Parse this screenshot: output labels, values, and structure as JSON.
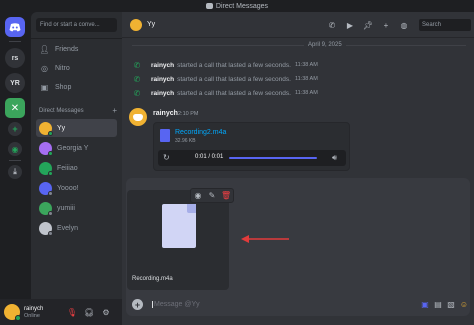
{
  "window": {
    "title": "Direct Messages"
  },
  "rail": {
    "servers": [
      {
        "label": "rs"
      },
      {
        "label": "YR"
      },
      {
        "label": ""
      }
    ]
  },
  "sidebar": {
    "search_placeholder": "Find or start a conve...",
    "nav": [
      {
        "label": "Friends",
        "icon": "friends-icon"
      },
      {
        "label": "Nitro",
        "icon": "nitro-icon"
      },
      {
        "label": "Shop",
        "icon": "shop-icon"
      }
    ],
    "dm_header": "Direct Messages",
    "dm_add": "+",
    "dms": [
      {
        "name": "Yy",
        "color": "#f0b232",
        "online": true,
        "active": true
      },
      {
        "name": "Georgia Y",
        "color": "#a56ef2",
        "online": true,
        "active": false
      },
      {
        "name": "Feiiiao",
        "color": "#23a55a",
        "online": true,
        "active": false
      },
      {
        "name": "Yoooo!",
        "color": "#5865f2",
        "online": false,
        "active": false
      },
      {
        "name": "yumiii",
        "color": "#3ba55c",
        "online": false,
        "active": false
      },
      {
        "name": "Evelyn",
        "color": "#c0c4cc",
        "online": false,
        "active": false
      }
    ]
  },
  "user": {
    "name": "rainych",
    "status": "Online"
  },
  "header": {
    "name": "Yy",
    "search_placeholder": "Search"
  },
  "chat": {
    "date": "April 9, 2025",
    "calls": [
      {
        "user": "rainych",
        "text": "started a call that lasted a few seconds.",
        "time": "11:38 AM"
      },
      {
        "user": "rainych",
        "text": "started a call that lasted a few seconds.",
        "time": "11:38 AM"
      },
      {
        "user": "rainych",
        "text": "started a call that lasted a few seconds.",
        "time": "11:38 AM"
      }
    ],
    "message": {
      "author": "rainych",
      "time": "2:10 PM",
      "attachment": {
        "filename": "Recording2.m4a",
        "size": "32.96 KB",
        "time": "0:01 / 0:01"
      }
    }
  },
  "upload": {
    "filename": "Recording.m4a",
    "input_placeholder": "Message @Yy"
  },
  "colors": {
    "accent": "#5865f2",
    "online": "#23a55a",
    "danger": "#f23f43",
    "link": "#00a8fc"
  }
}
